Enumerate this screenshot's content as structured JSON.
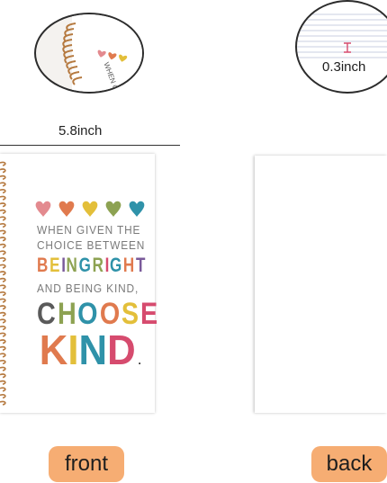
{
  "zoom_left": {
    "cover_text": [
      "WHEN G",
      "CHOIC",
      "BEIN"
    ]
  },
  "zoom_right": {
    "thickness": "0.3inch"
  },
  "dimension": {
    "width_label": "5.8inch"
  },
  "front": {
    "quote": {
      "line1": "WHEN GIVEN THE",
      "line2": "CHOICE BETWEEN",
      "line3_letters": [
        "B",
        "E",
        "I",
        "N",
        "G",
        " ",
        "R",
        "I",
        "G",
        "H",
        "T"
      ],
      "line4": "AND BEING KIND,",
      "line5_letters": [
        "C",
        "H",
        "O",
        "O",
        "S",
        "E"
      ],
      "line6_letters": [
        "K",
        "I",
        "N",
        "D"
      ],
      "line6_end": "."
    },
    "heart_colors": [
      "#e38a8f",
      "#e07a4e",
      "#e3bf3a",
      "#8da252",
      "#2f92a9"
    ],
    "label": "front"
  },
  "back": {
    "label": "back"
  },
  "colors": {
    "label_bg": "#f6ad73",
    "spiral": "#b5793f",
    "quote_gray": "#7a7a7a"
  }
}
